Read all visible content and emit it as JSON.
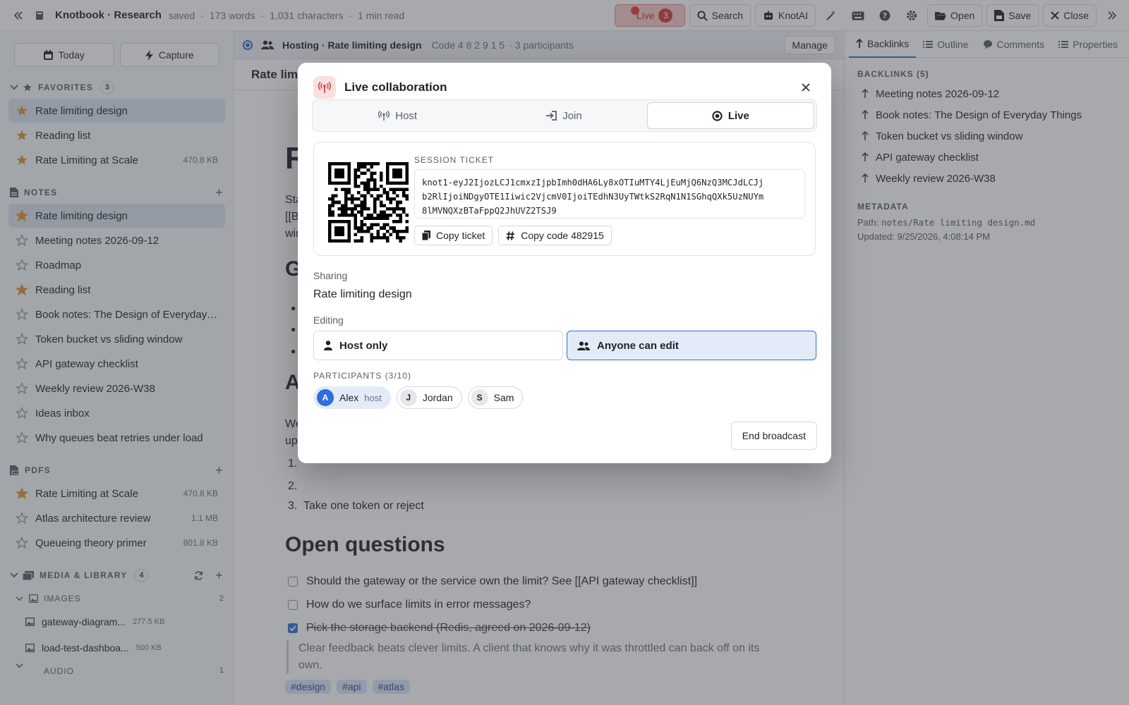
{
  "topbar": {
    "title": "Knotbook · Research",
    "status": "saved",
    "words": "173 words",
    "chars": "1,031 characters",
    "read": "1 min read",
    "live_label": "Live",
    "live_count": "3",
    "search_label": "Search",
    "ai_label": "KnotAI",
    "open_label": "Open",
    "save_label": "Save",
    "close_label": "Close"
  },
  "sidebar": {
    "today_label": "Today",
    "capture_label": "Capture",
    "favorites": {
      "heading": "FAVORITES",
      "count": "3",
      "items": [
        {
          "label": "Rate limiting design",
          "size": ""
        },
        {
          "label": "Reading list",
          "size": ""
        },
        {
          "label": "Rate Limiting at Scale",
          "size": "470.8 KB"
        }
      ]
    },
    "notes": {
      "heading": "NOTES",
      "items": [
        {
          "label": "Rate limiting design",
          "starred": true
        },
        {
          "label": "Meeting notes 2026-09-12",
          "starred": false
        },
        {
          "label": "Roadmap",
          "starred": false
        },
        {
          "label": "Reading list",
          "starred": true
        },
        {
          "label": "Book notes: The Design of Everyday ...",
          "starred": false
        },
        {
          "label": "Token bucket vs sliding window",
          "starred": false
        },
        {
          "label": "API gateway checklist",
          "starred": false
        },
        {
          "label": "Weekly review 2026-W38",
          "starred": false
        },
        {
          "label": "Ideas inbox",
          "starred": false
        },
        {
          "label": "Why queues beat retries under load",
          "starred": false
        }
      ]
    },
    "pdfs": {
      "heading": "PDFS",
      "items": [
        {
          "label": "Rate Limiting at Scale",
          "size": "470.8 KB",
          "starred": true
        },
        {
          "label": "Atlas architecture review",
          "size": "1.1 MB",
          "starred": false
        },
        {
          "label": "Queueing theory primer",
          "size": "801.8 KB",
          "starred": false
        }
      ]
    },
    "media": {
      "heading": "MEDIA & LIBRARY",
      "count": "4",
      "images_heading": "IMAGES",
      "images_count": "2",
      "images": [
        {
          "label": "gateway-diagram...",
          "size": "277.5 KB"
        },
        {
          "label": "load-test-dashboa...",
          "size": "500 KB"
        }
      ],
      "audio_heading": "AUDIO",
      "audio_count": "1"
    }
  },
  "collab_bar": {
    "name": "Hosting · Rate limiting design",
    "code": "Code 4 8 2 9 1 5",
    "participants": "· 3 participants",
    "manage_label": "Manage"
  },
  "editor": {
    "tab_title": "Rate lim",
    "doc_title_fragment": "R",
    "intro_fragments": [
      "Sta",
      "[[B",
      "wir"
    ],
    "h_goals_fragment": "G",
    "h_a_fragment": "A",
    "para_fragments": [
      "We",
      "up"
    ],
    "list_step3": "Take one token or reject",
    "open_questions_heading": "Open questions",
    "todos": [
      {
        "text": "Should the gateway or the service own the limit? See [[API gateway checklist]]",
        "done": false
      },
      {
        "text": "How do we surface limits in error messages?",
        "done": false
      },
      {
        "text": "Pick the storage backend (Redis, agreed on 2026-09-12)",
        "done": true
      }
    ],
    "quote": "Clear feedback beats clever limits. A client that knows why it was throttled can back off on its own.",
    "tags": [
      "#design",
      "#api",
      "#atlas"
    ]
  },
  "rightpanel": {
    "tabs": [
      "Backlinks",
      "Outline",
      "Comments",
      "Properties"
    ],
    "backlinks_heading": "BACKLINKS (5)",
    "backlinks": [
      "Meeting notes 2026-09-12",
      "Book notes: The Design of Everyday Things",
      "Token bucket vs sliding window",
      "API gateway checklist",
      "Weekly review 2026-W38"
    ],
    "metadata_heading": "METADATA",
    "path_label": "Path:",
    "path_value": "notes/Rate limiting design.md",
    "updated": "Updated: 9/25/2026, 4:08:14 PM"
  },
  "modal": {
    "title": "Live collaboration",
    "tabs": {
      "host": "Host",
      "join": "Join",
      "live": "Live"
    },
    "ticket_label": "SESSION TICKET",
    "ticket_lines": [
      "knot1-eyJ2IjozLCJ1cmxzIjpbImh0dHA6Ly8xOTIuMTY4LjEuMjQ6NzQ3MCJdLCJj",
      "b2RlIjoiNDgyOTE1Iiwic2VjcmV0IjoiTEdhN3UyTWtkS2RqN1N1SGhqQXk5UzNUYm",
      "8lMVNQXzBTaFppQ2JhUVZ2TSJ9"
    ],
    "copy_ticket_label": "Copy ticket",
    "copy_code_label": "Copy code 482915",
    "sharing_label": "Sharing",
    "sharing_value": "Rate limiting design",
    "editing_label": "Editing",
    "host_only_label": "Host only",
    "anyone_label": "Anyone can edit",
    "participants_label": "PARTICIPANTS (3/10)",
    "participants": [
      {
        "initial": "A",
        "name": "Alex",
        "role": "host"
      },
      {
        "initial": "J",
        "name": "Jordan",
        "role": ""
      },
      {
        "initial": "S",
        "name": "Sam",
        "role": ""
      }
    ],
    "end_label": "End broadcast"
  },
  "colors": {
    "accent": "#2f6de1",
    "star": "#e0932b",
    "live_red": "#d9363e",
    "tag_bg": "#dbe6f7"
  }
}
